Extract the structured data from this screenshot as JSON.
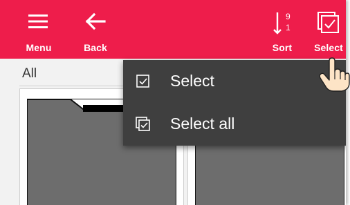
{
  "colors": {
    "toolbar": "#ee1d4b",
    "menu_bg": "#3f3f3f",
    "page_bg": "#f2f2f2",
    "folder": "#6d6d6d"
  },
  "toolbar": {
    "menu": {
      "label": "Menu",
      "icon": "hamburger-icon"
    },
    "back": {
      "label": "Back",
      "icon": "back-arrow-icon"
    },
    "sort": {
      "label": "Sort",
      "icon": "sort-icon",
      "top_digit": "9",
      "bottom_digit": "1"
    },
    "select": {
      "label": "Select",
      "icon": "select-checkbox-icon"
    }
  },
  "filter": {
    "label": "All"
  },
  "dropdown": {
    "items": [
      {
        "label": "Select",
        "icon": "checkbox-icon"
      },
      {
        "label": "Select all",
        "icon": "select-all-icon"
      }
    ]
  },
  "pointer": {
    "icon": "hand-pointer-icon"
  }
}
